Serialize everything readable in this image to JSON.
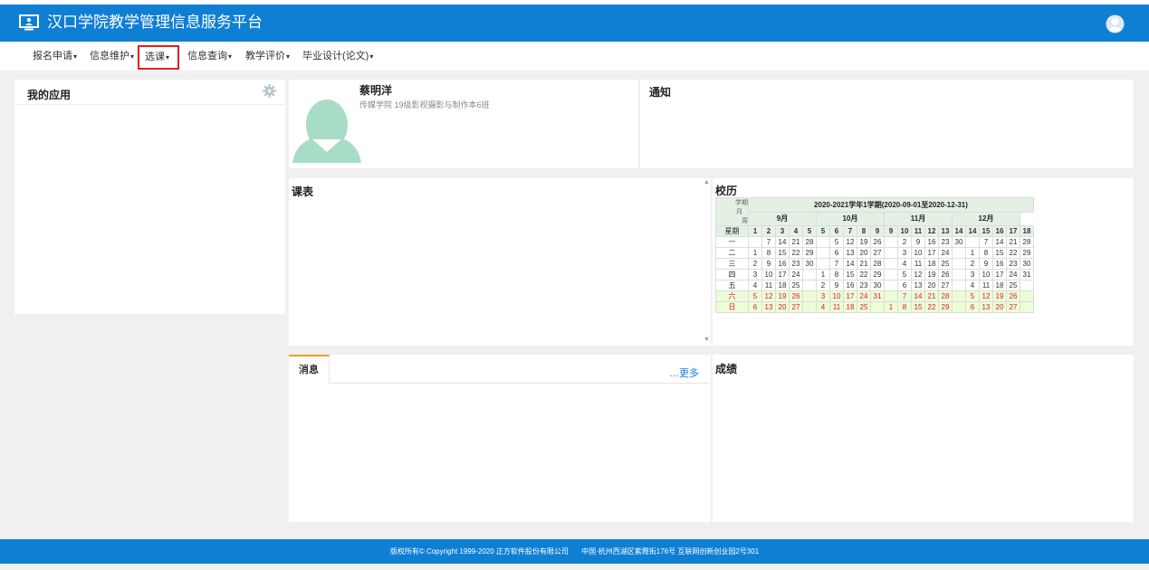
{
  "header": {
    "title": "汉口学院教学管理信息服务平台",
    "logo_icon": "monitor-user-icon",
    "avatar_icon": "user-avatar-icon",
    "brand_color": "#0f7fd4"
  },
  "nav": {
    "items": [
      {
        "label": "报名申请",
        "active": false
      },
      {
        "label": "信息维护",
        "active": false
      },
      {
        "label": "选课",
        "active": true
      },
      {
        "label": "信息查询",
        "active": false
      },
      {
        "label": "教学评价",
        "active": false
      },
      {
        "label": "毕业设计(论文)",
        "active": false
      }
    ],
    "caret": "▾",
    "highlight_color": "#e0201f"
  },
  "my_apps": {
    "title": "我的应用",
    "settings_icon": "gear-icon"
  },
  "profile": {
    "name": "蔡明洋",
    "info": "传媒学院 19级影视摄影与制作本6班"
  },
  "notice": {
    "title": "通知"
  },
  "schedule": {
    "title": "课表"
  },
  "calendar": {
    "title": "校历",
    "term": "2020-2021学年1学期(2020-09-01至2020-12-31)",
    "corner": {
      "term_lbl": "学期",
      "month_lbl": "月",
      "week_lbl": "周",
      "weekday_lbl": "星期"
    },
    "months": [
      {
        "label": "9月",
        "span": 5
      },
      {
        "label": "10月",
        "span": 5
      },
      {
        "label": "11月",
        "span": 5
      },
      {
        "label": "12月",
        "span": 4
      }
    ],
    "weeks": [
      "1",
      "2",
      "3",
      "4",
      "5",
      "5",
      "6",
      "7",
      "8",
      "9",
      "9",
      "10",
      "11",
      "12",
      "13",
      "14",
      "14",
      "15",
      "16",
      "17",
      "18"
    ],
    "rows": [
      {
        "day": "一",
        "cells": [
          "",
          "7",
          "14",
          "21",
          "28",
          "",
          "5",
          "12",
          "19",
          "26",
          "",
          "2",
          "9",
          "16",
          "23",
          "30",
          "",
          "7",
          "14",
          "21",
          "28"
        ],
        "weekend": false
      },
      {
        "day": "二",
        "cells": [
          "1",
          "8",
          "15",
          "22",
          "29",
          "",
          "6",
          "13",
          "20",
          "27",
          "",
          "3",
          "10",
          "17",
          "24",
          "",
          "1",
          "8",
          "15",
          "22",
          "29"
        ],
        "weekend": false
      },
      {
        "day": "三",
        "cells": [
          "2",
          "9",
          "16",
          "23",
          "30",
          "",
          "7",
          "14",
          "21",
          "28",
          "",
          "4",
          "11",
          "18",
          "25",
          "",
          "2",
          "9",
          "16",
          "23",
          "30"
        ],
        "weekend": false
      },
      {
        "day": "四",
        "cells": [
          "3",
          "10",
          "17",
          "24",
          "",
          "1",
          "8",
          "15",
          "22",
          "29",
          "",
          "5",
          "12",
          "19",
          "26",
          "",
          "3",
          "10",
          "17",
          "24",
          "31"
        ],
        "weekend": false
      },
      {
        "day": "五",
        "cells": [
          "4",
          "11",
          "18",
          "25",
          "",
          "2",
          "9",
          "16",
          "23",
          "30",
          "",
          "6",
          "13",
          "20",
          "27",
          "",
          "4",
          "11",
          "18",
          "25",
          ""
        ],
        "weekend": false
      },
      {
        "day": "六",
        "cells": [
          "5",
          "12",
          "19",
          "26",
          "",
          "3",
          "10",
          "17",
          "24",
          "31",
          "",
          "7",
          "14",
          "21",
          "28",
          "",
          "5",
          "12",
          "19",
          "26",
          ""
        ],
        "weekend": true
      },
      {
        "day": "日",
        "cells": [
          "6",
          "13",
          "20",
          "27",
          "",
          "4",
          "11",
          "18",
          "25",
          "",
          "1",
          "8",
          "15",
          "22",
          "29",
          "",
          "6",
          "13",
          "20",
          "27",
          ""
        ],
        "weekend": true
      }
    ],
    "weekend_color": "#e0201f"
  },
  "news": {
    "tab_label": "消息",
    "more_label": "更多"
  },
  "grades": {
    "title": "成绩"
  },
  "footer": {
    "copyright": "版权所有© Copyright 1999-2020 正方软件股份有限公司",
    "address": "中国·杭州西湖区紫霞街176号 互联网创新创业园2号301"
  }
}
